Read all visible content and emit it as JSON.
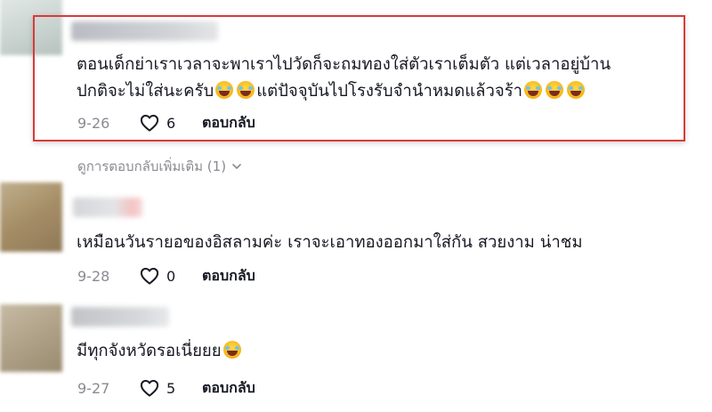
{
  "comments": [
    {
      "text_line1": "ตอนเด็กย่าเราเวลาจะพาเราไปวัดก็จะถมทองใส่ตัวเราเต็มตัว แต่เวลาอยู่บ้าน",
      "text_line2_part1": "ปกติจะไม่ใส่นะครับ",
      "text_line2_part2": "แต่ปัจจุบันไปโรงรับจำนำหมดแล้วจร้า",
      "date": "9-26",
      "likes": "6",
      "reply_label": "ตอบกลับ",
      "view_replies_label": "ดูการตอบกลับเพิ่มเติม (1)"
    },
    {
      "text": "เหมือนวันรายอของอิสลามค่ะ เราจะเอาทองออกมาใส่กัน สวยงาม น่าชม",
      "date": "9-28",
      "likes": "0",
      "reply_label": "ตอบกลับ"
    },
    {
      "text": "มีทุกจังหวัดรอเนี่ยยย",
      "date": "9-27",
      "likes": "5",
      "reply_label": "ตอบกลับ"
    }
  ],
  "icons": {
    "like": "heart-outline-icon",
    "expand": "chevron-down-icon",
    "emoji": "face-with-tears-of-joy-emoji"
  },
  "colors": {
    "highlight_border": "#d83a3a",
    "text_primary": "#161823",
    "text_secondary": "#8a8b91"
  }
}
